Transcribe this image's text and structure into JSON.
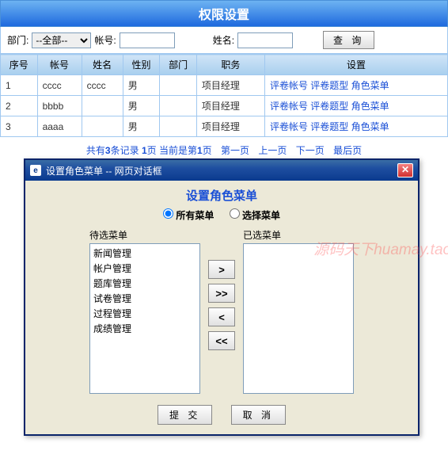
{
  "header": {
    "title": "权限设置"
  },
  "filters": {
    "dept_label": "部门:",
    "dept_value": "--全部--",
    "acct_label": "帐号:",
    "acct_value": "",
    "name_label": "姓名:",
    "name_value": "",
    "search_label": "查 询"
  },
  "table": {
    "columns": [
      "序号",
      "帐号",
      "姓名",
      "性别",
      "部门",
      "职务",
      "设置"
    ],
    "rows": [
      {
        "no": "1",
        "acct": "cccc",
        "name": "cccc",
        "gender": "男",
        "dept": "",
        "role": "项目经理"
      },
      {
        "no": "2",
        "acct": "bbbb",
        "name": "",
        "gender": "男",
        "dept": "",
        "role": "项目经理"
      },
      {
        "no": "3",
        "acct": "aaaa",
        "name": "",
        "gender": "男",
        "dept": "",
        "role": "项目经理"
      }
    ],
    "settings_links": [
      "评卷帐号",
      "评卷题型",
      "角色菜单"
    ]
  },
  "pagination": {
    "summary_prefix": "共有",
    "count": "3",
    "summary_mid": "条记录 ",
    "pages": "1",
    "summary_page_word": "页 当前是第",
    "current": "1",
    "summary_end": "页",
    "first": "第一页",
    "prev": "上一页",
    "next": "下一页",
    "last": "最后页"
  },
  "dialog": {
    "titlebar": "设置角色菜单 -- 网页对话框",
    "heading": "设置角色菜单",
    "radio_all": "所有菜单",
    "radio_select": "选择菜单",
    "left_label": "待选菜单",
    "right_label": "已选菜单",
    "left_items": [
      "新闻管理",
      "帐户管理",
      "题库管理",
      "试卷管理",
      "过程管理",
      "成绩管理"
    ],
    "right_items": [],
    "arrows": {
      "add": ">",
      "addAll": ">>",
      "remove": "<",
      "removeAll": "<<"
    },
    "submit": "提 交",
    "cancel": "取 消"
  },
  "watermark": "源码天下huamay.taoba.c"
}
